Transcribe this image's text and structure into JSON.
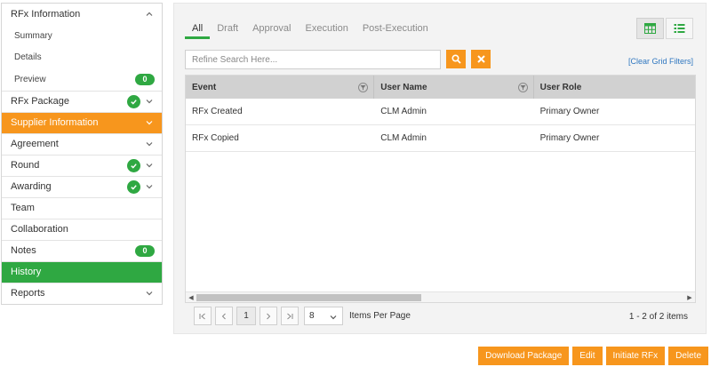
{
  "sidebar": {
    "header": "RFx Information",
    "summary": "Summary",
    "details": "Details",
    "preview": "Preview",
    "preview_count": "0",
    "package": "RFx Package",
    "supplier_info": "Supplier Information",
    "agreement": "Agreement",
    "round": "Round",
    "awarding": "Awarding",
    "team": "Team",
    "collaboration": "Collaboration",
    "notes": "Notes",
    "notes_count": "0",
    "history": "History",
    "reports": "Reports"
  },
  "tabs": [
    "All",
    "Draft",
    "Approval",
    "Execution",
    "Post-Execution"
  ],
  "search": {
    "placeholder": "Refine Search Here..."
  },
  "clear_filters": "[Clear Grid Filters]",
  "grid": {
    "headers": [
      "Event",
      "User Name",
      "User Role"
    ],
    "rows": [
      [
        "RFx Created",
        "CLM Admin",
        "Primary Owner"
      ],
      [
        "RFx Copied",
        "CLM Admin",
        "Primary Owner"
      ]
    ]
  },
  "pager": {
    "current_page": "1",
    "page_size": "8",
    "items_per_page_label": "Items Per Page",
    "items_count": "1 - 2 of 2 items"
  },
  "actions": {
    "download": "Download Package",
    "edit": "Edit",
    "initiate": "Initiate RFx",
    "delete": "Delete"
  },
  "colors": {
    "accent_orange": "#f7961d",
    "accent_green": "#2fa842",
    "link_blue": "#2f77c0"
  },
  "icons": {
    "collapse": "chevron-up-icon",
    "expand": "chevron-down-icon",
    "complete": "check-circle-icon",
    "grid_view": "grid-view-icon",
    "list_view": "list-view-icon",
    "search": "search-icon",
    "clear": "close-icon",
    "filter": "filter-icon"
  }
}
